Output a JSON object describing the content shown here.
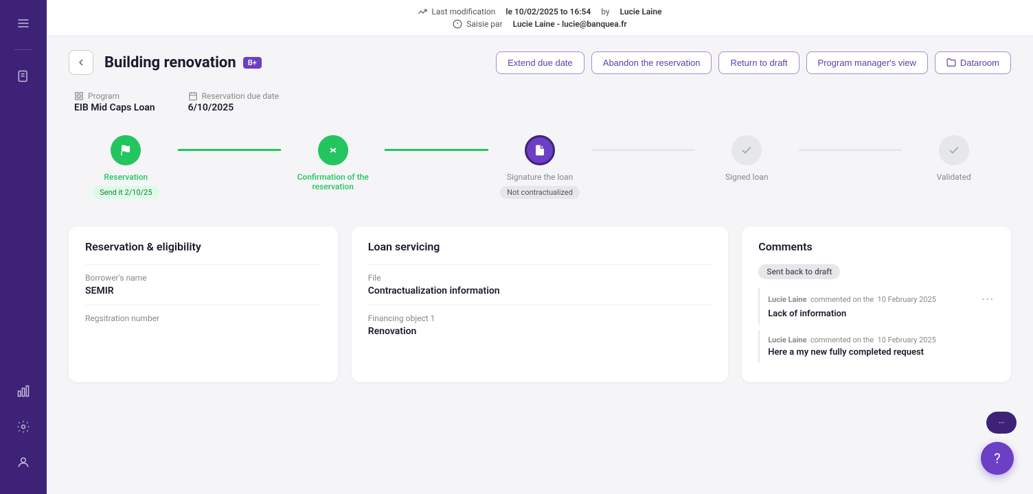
{
  "topbar": {
    "line1_prefix": "Last modification",
    "line1_date": "le 10/02/2025 to 16:54",
    "line1_by": "by",
    "line1_user": "Lucie Laine",
    "line2_prefix": "Saisie par",
    "line2_user": "Lucie Laine - lucie@banquea.fr"
  },
  "page": {
    "title": "Building renovation",
    "badge": "B+",
    "back_label": "←"
  },
  "actions": {
    "extend": "Extend due date",
    "abandon": "Abandon the reservation",
    "return_draft": "Return to draft",
    "program_mgr": "Program manager's view",
    "dataroom": "Dataroom"
  },
  "meta": {
    "program_label": "Program",
    "program_value": "EIB Mid Caps Loan",
    "due_date_label": "Reservation due date",
    "due_date_value": "6/10/2025"
  },
  "steps": [
    {
      "label": "Reservation",
      "status": "completed",
      "sub": "Send it 2/10/25",
      "sub_style": "green"
    },
    {
      "label": "Confirmation of the reservation",
      "status": "completed",
      "sub": "",
      "sub_style": ""
    },
    {
      "label": "Signature the loan",
      "status": "active",
      "sub": "Not contractualized",
      "sub_style": "gray"
    },
    {
      "label": "Signed loan",
      "status": "pending",
      "sub": "",
      "sub_style": ""
    },
    {
      "label": "Validated",
      "status": "pending",
      "sub": "",
      "sub_style": ""
    }
  ],
  "reservation_card": {
    "title": "Reservation & eligibility",
    "borrower_label": "Borrower's name",
    "borrower_value": "SEMIR",
    "registration_label": "Regsitration number",
    "registration_value": ""
  },
  "loan_card": {
    "title": "Loan servicing",
    "file_label": "File",
    "file_value": "Contractualization information",
    "financing_label": "Financing object 1",
    "financing_value": "Renovation"
  },
  "comments_card": {
    "title": "Comments",
    "badge": "Sent back to draft",
    "comment1_user": "Lucie Laine",
    "comment1_action": "commented on the",
    "comment1_date": "10 February 2025",
    "comment1_text": "Lack of information",
    "comment2_user": "Lucie Laine",
    "comment2_action": "commented on the",
    "comment2_date": "10 February 2025",
    "comment2_text": "Here a my new fully completed request"
  },
  "fab": {
    "label": "?",
    "chat_label": "···"
  },
  "sidebar": {
    "menu_icon": "☰",
    "divider": "—",
    "note_icon": "📋",
    "chart_icon": "📊",
    "gear_icon": "⚙",
    "user_icon": "👤"
  }
}
